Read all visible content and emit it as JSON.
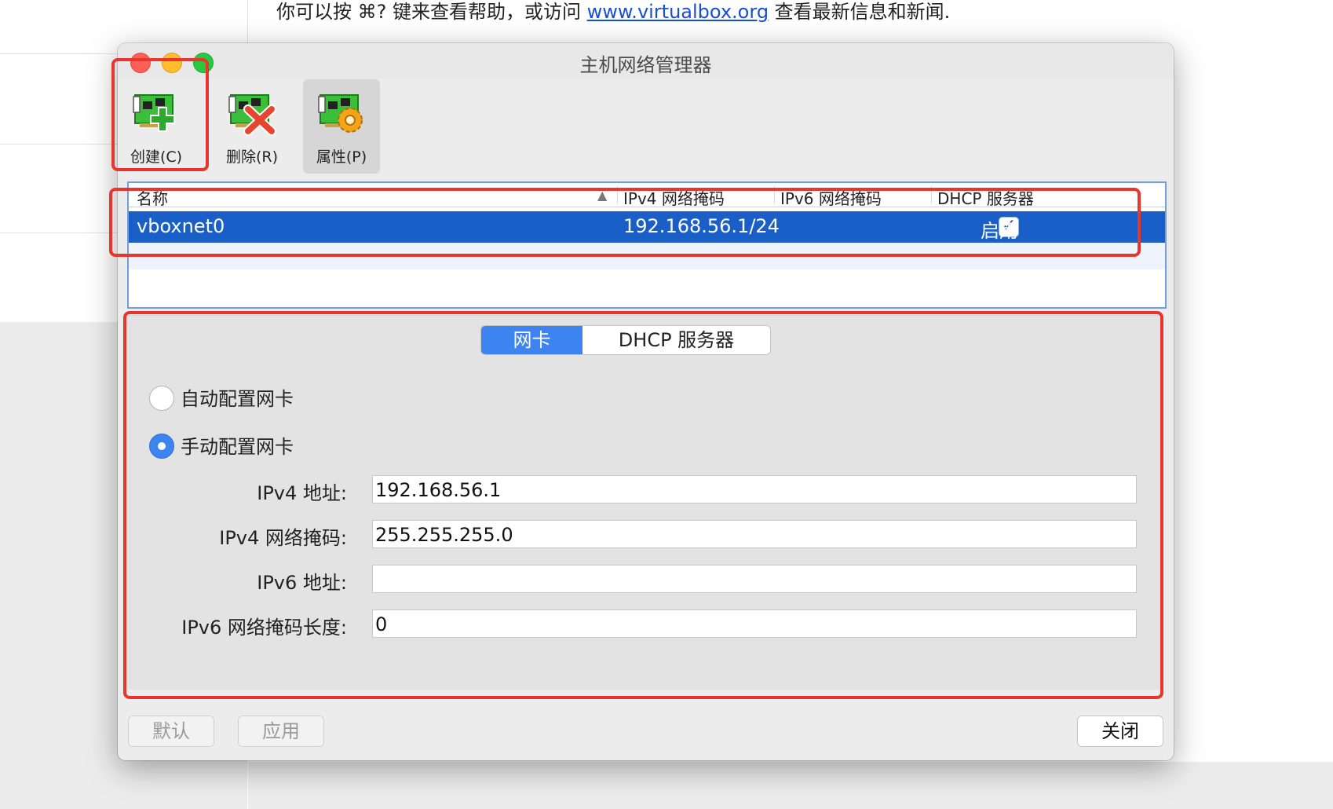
{
  "background": {
    "help_prefix": "你可以按 ⌘? 键来查看帮助，或访问 ",
    "help_link": "www.virtualbox.org",
    "help_suffix": " 查看最新信息和新闻."
  },
  "window": {
    "title": "主机网络管理器"
  },
  "toolbar": {
    "create_label": "创建(C)",
    "remove_label": "删除(R)",
    "properties_label": "属性(P)"
  },
  "table": {
    "columns": [
      "名称",
      "IPv4 网络掩码",
      "IPv6 网络掩码",
      "DHCP 服务器"
    ],
    "rows": [
      {
        "name": "vboxnet0",
        "ipv4_mask": "192.168.56.1/24",
        "ipv6_mask": "",
        "dhcp_enabled": true,
        "dhcp_label": "启用"
      }
    ]
  },
  "details": {
    "tabs": [
      "网卡",
      "DHCP 服务器"
    ],
    "auto_label": "自动配置网卡",
    "manual_label": "手动配置网卡",
    "ipv4_addr_label": "IPv4 地址:",
    "ipv4_addr_value": "192.168.56.1",
    "ipv4_mask_label": "IPv4 网络掩码:",
    "ipv4_mask_value": "255.255.255.0",
    "ipv6_addr_label": "IPv6 地址:",
    "ipv6_addr_value": "",
    "ipv6_len_label": "IPv6 网络掩码长度:",
    "ipv6_len_value": "0"
  },
  "buttons": {
    "reset": "默认",
    "apply": "应用",
    "close": "关闭"
  },
  "colors": {
    "selection": "#1a5fc8",
    "accent": "#3d84f0",
    "highlight": "#e8352d"
  }
}
